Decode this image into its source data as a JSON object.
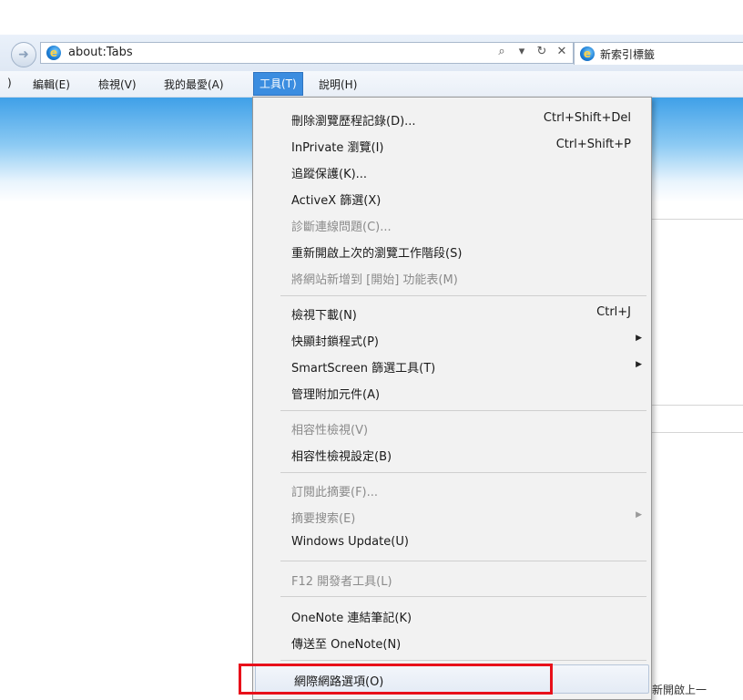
{
  "browser": {
    "address": "about:Tabs",
    "tab_title": "新索引標籤",
    "addr_tools": [
      "⌕",
      "▾",
      "↻",
      "✕"
    ]
  },
  "menubar": {
    "items": [
      {
        "label": ")"
      },
      {
        "label": "編輯(E)"
      },
      {
        "label": "檢視(V)"
      },
      {
        "label": "我的最愛(A)"
      },
      {
        "label": "工具(T)"
      },
      {
        "label": "說明(H)"
      }
    ],
    "active_index": 4
  },
  "tools_menu": {
    "items": [
      {
        "label": "刪除瀏覽歷程記錄(D)...",
        "shortcut": "Ctrl+Shift+Del",
        "enabled": true
      },
      {
        "label": "InPrivate 瀏覽(I)",
        "shortcut": "Ctrl+Shift+P",
        "enabled": true
      },
      {
        "label": "追蹤保護(K)...",
        "enabled": true
      },
      {
        "label": "ActiveX 篩選(X)",
        "enabled": true
      },
      {
        "label": "診斷連線問題(C)...",
        "enabled": false
      },
      {
        "label": "重新開啟上次的瀏覽工作階段(S)",
        "enabled": true
      },
      {
        "label": "將網站新增到 [開始] 功能表(M)",
        "enabled": false
      },
      {
        "label": "檢視下載(N)",
        "shortcut": "Ctrl+J",
        "enabled": true
      },
      {
        "label": "快顯封鎖程式(P)",
        "submenu": true,
        "enabled": true
      },
      {
        "label": "SmartScreen 篩選工具(T)",
        "submenu": true,
        "enabled": true
      },
      {
        "label": "管理附加元件(A)",
        "enabled": true
      },
      {
        "label": "相容性檢視(V)",
        "enabled": false
      },
      {
        "label": "相容性檢視設定(B)",
        "enabled": true
      },
      {
        "label": "訂閱此摘要(F)...",
        "enabled": false
      },
      {
        "label": "摘要搜索(E)",
        "submenu": true,
        "enabled": false
      },
      {
        "label": "Windows Update(U)",
        "enabled": true
      },
      {
        "label": "F12 開發者工具(L)",
        "enabled": false
      },
      {
        "label": "OneNote 連結筆記(K)",
        "enabled": true
      },
      {
        "label": "傳送至 OneNote(N)",
        "enabled": true
      },
      {
        "label": "網際網路選項(O)",
        "enabled": true,
        "highlighted": true
      }
    ]
  },
  "page": {
    "partial_text": "新開啟上一"
  },
  "colors": {
    "highlight_box": "#e8101a",
    "menu_active": "#3b8de0"
  }
}
